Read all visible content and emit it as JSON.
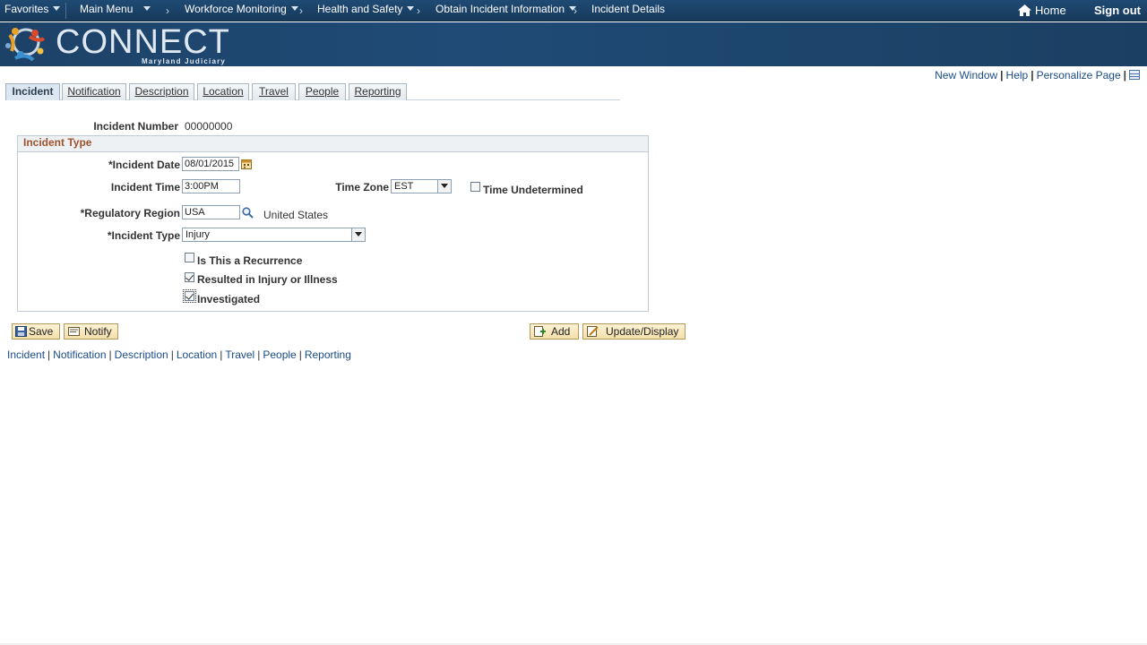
{
  "topnav": {
    "favorites": "Favorites",
    "main_menu": "Main Menu",
    "breadcrumbs": [
      "Workforce Monitoring",
      "Health and Safety",
      "Obtain Incident Information",
      "Incident Details"
    ],
    "home": "Home",
    "sign_out": "Sign out"
  },
  "banner": {
    "logo_text": "CONNECT",
    "logo_sub": "Maryland Judiciary"
  },
  "page_links": {
    "new_window": "New Window",
    "help": "Help",
    "personalize": "Personalize Page"
  },
  "tabs": [
    {
      "label": "Incident",
      "active": true
    },
    {
      "label": "Notification"
    },
    {
      "label": "Description"
    },
    {
      "label": "Location"
    },
    {
      "label": "Travel"
    },
    {
      "label": "People"
    },
    {
      "label": "Reporting"
    }
  ],
  "form": {
    "incident_number_label": "Incident Number",
    "incident_number": "00000000",
    "group_title": "Incident Type",
    "incident_date_label": "*Incident Date",
    "incident_date": "08/01/2015",
    "incident_time_label": "Incident Time",
    "incident_time": "3:00PM",
    "time_zone_label": "Time Zone",
    "time_zone": "EST",
    "time_undetermined_label": "Time Undetermined",
    "time_undetermined": false,
    "regulatory_region_label": "*Regulatory Region",
    "regulatory_region": "USA",
    "regulatory_region_desc": "United States",
    "incident_type_label": "*Incident Type",
    "incident_type": "Injury",
    "recurrence_label": "Is This a Recurrence",
    "recurrence": false,
    "injury_label": "Resulted in Injury or Illness",
    "injury": true,
    "investigated_label": "Investigated",
    "investigated": true
  },
  "buttons": {
    "save": "Save",
    "notify": "Notify",
    "add": "Add",
    "update_display": "Update/Display"
  },
  "bottom_links": [
    "Incident",
    "Notification",
    "Description",
    "Location",
    "Travel",
    "People",
    "Reporting"
  ]
}
